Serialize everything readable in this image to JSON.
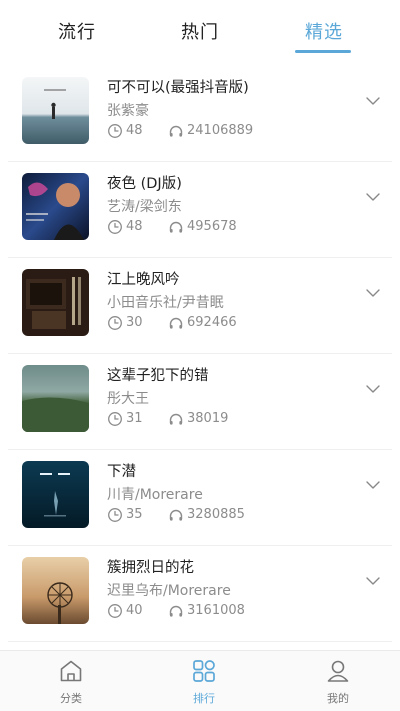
{
  "tabs": [
    "流行",
    "热门",
    "精选"
  ],
  "active_tab": 2,
  "accent_color": "#5ba8d8",
  "songs": [
    {
      "title": "可不可以(最强抖音版)",
      "artist": "张紫豪",
      "duration": "48",
      "plays": "24106889"
    },
    {
      "title": "夜色 (DJ版)",
      "artist": "艺涛/梁剑东",
      "duration": "48",
      "plays": "495678"
    },
    {
      "title": "江上晚风吟",
      "artist": "小田音乐社/尹昔眠",
      "duration": "30",
      "plays": "692466"
    },
    {
      "title": "这辈子犯下的错",
      "artist": "彤大王",
      "duration": "31",
      "plays": "38019"
    },
    {
      "title": "下潜",
      "artist": "川青/Morerare",
      "duration": "35",
      "plays": "3280885"
    },
    {
      "title": "簇拥烈日的花",
      "artist": "迟里乌布/Morerare",
      "duration": "40",
      "plays": "3161008"
    }
  ],
  "icons": {
    "duration": "clock-icon",
    "plays": "headphones-icon",
    "expand": "chevron-down-icon"
  },
  "nav": [
    {
      "label": "分类",
      "icon": "home-icon"
    },
    {
      "label": "排行",
      "icon": "grid-icon"
    },
    {
      "label": "我的",
      "icon": "user-icon"
    }
  ],
  "active_nav": 1
}
